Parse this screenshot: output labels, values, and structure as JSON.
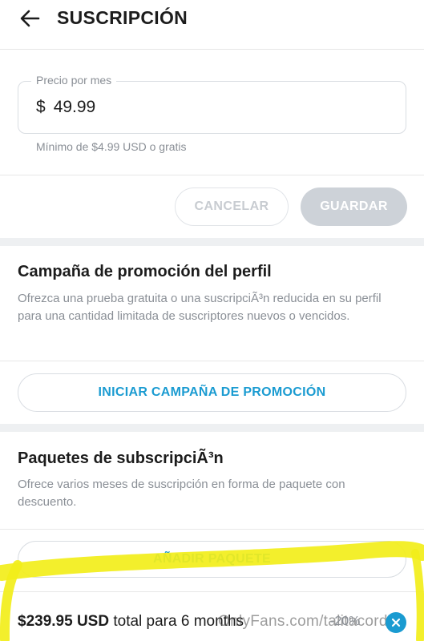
{
  "header": {
    "title": "SUSCRIPCIÓN",
    "back_icon": "arrow-left-icon"
  },
  "price": {
    "label": "Precio por mes",
    "currency": "$",
    "value": "49.99",
    "hint": "Mínimo de $4.99 USD o gratis"
  },
  "actions": {
    "cancel": "CANCELAR",
    "save": "GUARDAR"
  },
  "promotion": {
    "title": "Campaña de promoción del perfil",
    "description": "Ofrezca una prueba gratuita o una suscripciÃ³n reducida en su perfil para una cantidad limitada de suscriptores nuevos o vencidos.",
    "button": "INICIAR CAMPAÑA DE PROMOCIÓN"
  },
  "bundles": {
    "title": "Paquetes de subscripciÃ³n",
    "description": "Ofrece varios meses de suscripción en forma de paquete con descuento.",
    "add_button": "AÑADIR PAQUETE",
    "items": [
      {
        "amount": "$239.95 USD",
        "suffix": " total para 6 months",
        "discount": "-20%",
        "remove_icon": "close-icon"
      }
    ]
  },
  "watermark": "OnlyFans.com/talitacorda",
  "colors": {
    "accent": "#1a9bd1",
    "highlighter": "#f2ee1a",
    "disabled": "#cdd2d8"
  }
}
